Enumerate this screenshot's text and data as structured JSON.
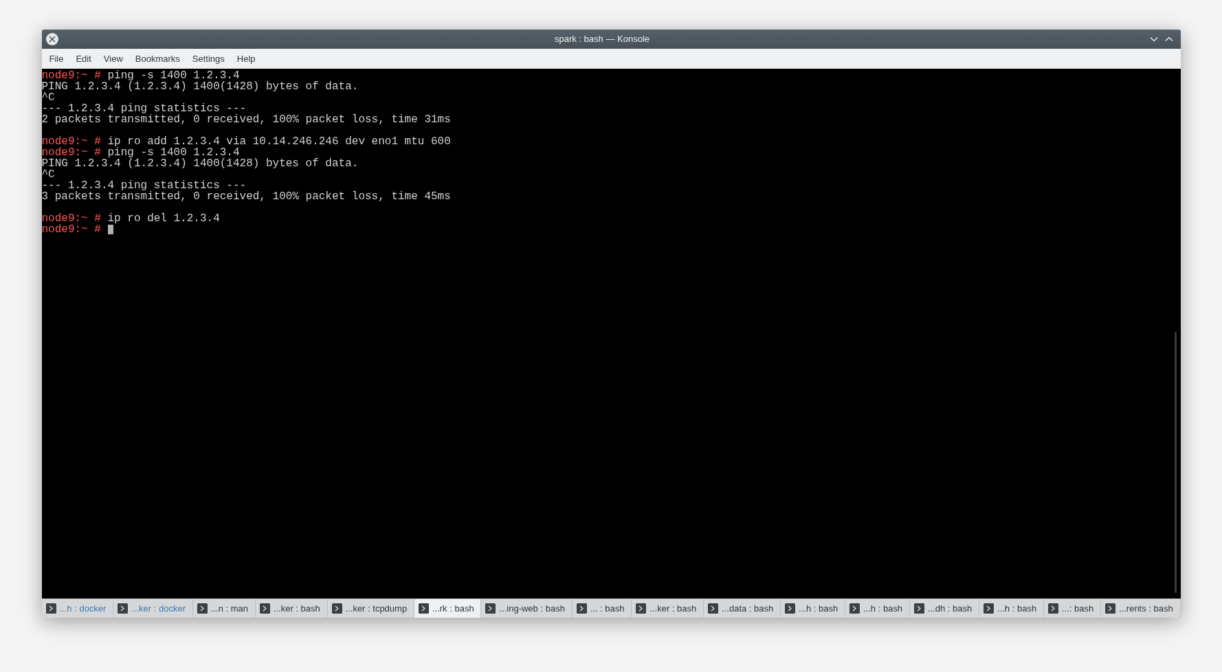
{
  "window": {
    "title": "spark : bash — Konsole"
  },
  "menu": [
    "File",
    "Edit",
    "View",
    "Bookmarks",
    "Settings",
    "Help"
  ],
  "terminal": {
    "lines": [
      {
        "kind": "prompt",
        "prompt": "node9:~ #",
        "text": "ping -s 1400 1.2.3.4",
        "cursor": false
      },
      {
        "kind": "output",
        "text": "PING 1.2.3.4 (1.2.3.4) 1400(1428) bytes of data."
      },
      {
        "kind": "output",
        "text": "^C"
      },
      {
        "kind": "output",
        "text": "--- 1.2.3.4 ping statistics ---"
      },
      {
        "kind": "output",
        "text": "2 packets transmitted, 0 received, 100% packet loss, time 31ms"
      },
      {
        "kind": "blank"
      },
      {
        "kind": "prompt",
        "prompt": "node9:~ #",
        "text": "ip ro add 1.2.3.4 via 10.14.246.246 dev eno1 mtu 600",
        "cursor": false
      },
      {
        "kind": "prompt",
        "prompt": "node9:~ #",
        "text": "ping -s 1400 1.2.3.4",
        "cursor": false
      },
      {
        "kind": "output",
        "text": "PING 1.2.3.4 (1.2.3.4) 1400(1428) bytes of data."
      },
      {
        "kind": "output",
        "text": "^C"
      },
      {
        "kind": "output",
        "text": "--- 1.2.3.4 ping statistics ---"
      },
      {
        "kind": "output",
        "text": "3 packets transmitted, 0 received, 100% packet loss, time 45ms"
      },
      {
        "kind": "blank"
      },
      {
        "kind": "prompt",
        "prompt": "node9:~ #",
        "text": "ip ro del 1.2.3.4",
        "cursor": false
      },
      {
        "kind": "prompt",
        "prompt": "node9:~ #",
        "cursor": true
      }
    ]
  },
  "tabs": [
    {
      "label": "...h : docker",
      "selected": false,
      "activity": true
    },
    {
      "label": "...ker : docker",
      "selected": false,
      "activity": true
    },
    {
      "label": "...n : man",
      "selected": false,
      "activity": false
    },
    {
      "label": "...ker : bash",
      "selected": false,
      "activity": false
    },
    {
      "label": "...ker : tcpdump",
      "selected": false,
      "activity": false
    },
    {
      "label": "...rk : bash",
      "selected": true,
      "activity": false
    },
    {
      "label": "...ing-web : bash",
      "selected": false,
      "activity": false
    },
    {
      "label": "... : bash",
      "selected": false,
      "activity": false
    },
    {
      "label": "...ker : bash",
      "selected": false,
      "activity": false
    },
    {
      "label": "...data : bash",
      "selected": false,
      "activity": false
    },
    {
      "label": "...h : bash",
      "selected": false,
      "activity": false
    },
    {
      "label": "...h : bash",
      "selected": false,
      "activity": false
    },
    {
      "label": "...dh : bash",
      "selected": false,
      "activity": false
    },
    {
      "label": "...h : bash",
      "selected": false,
      "activity": false
    },
    {
      "label": "...: bash",
      "selected": false,
      "activity": false
    },
    {
      "label": "...rents : bash",
      "selected": false,
      "activity": false
    }
  ]
}
